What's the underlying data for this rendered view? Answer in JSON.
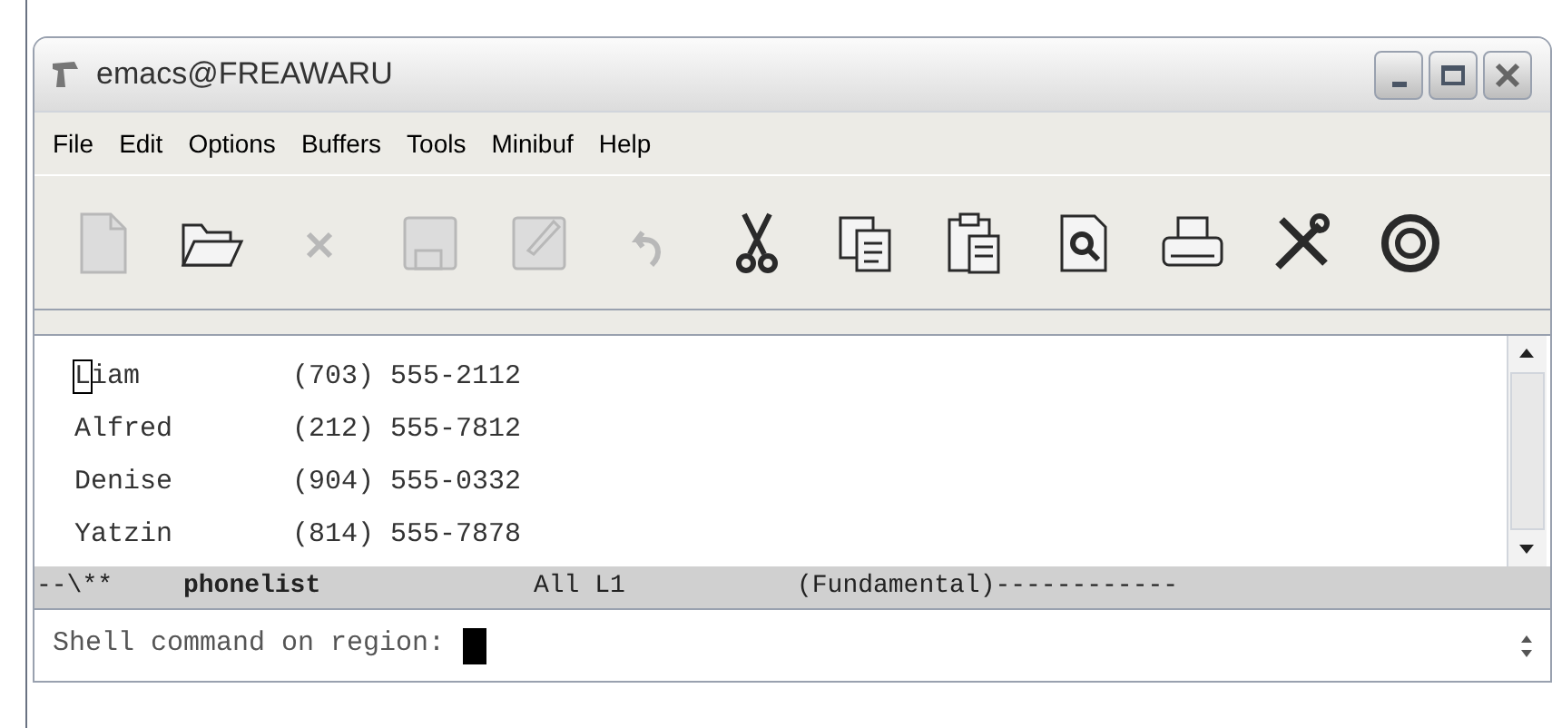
{
  "window": {
    "title": "emacs@FREAWARU"
  },
  "menu": [
    "File",
    "Edit",
    "Options",
    "Buffers",
    "Tools",
    "Minibuf",
    "Help"
  ],
  "toolbar": [
    {
      "kind": "new",
      "disabled": true
    },
    {
      "kind": "open",
      "disabled": false
    },
    {
      "kind": "close",
      "disabled": true
    },
    {
      "kind": "save",
      "disabled": true
    },
    {
      "kind": "saveas",
      "disabled": true
    },
    {
      "kind": "undo",
      "disabled": true
    },
    {
      "kind": "cut",
      "disabled": false
    },
    {
      "kind": "copy",
      "disabled": false
    },
    {
      "kind": "paste",
      "disabled": false
    },
    {
      "kind": "search",
      "disabled": false
    },
    {
      "kind": "print",
      "disabled": false
    },
    {
      "kind": "tools",
      "disabled": false
    },
    {
      "kind": "help",
      "disabled": false
    }
  ],
  "buffer": {
    "lines": [
      {
        "name": "Liam",
        "phone": "(703) 555-2112",
        "cursor": true
      },
      {
        "name": "Alfred",
        "phone": "(212) 555-7812",
        "cursor": false
      },
      {
        "name": "Denise",
        "phone": "(904) 555-0332",
        "cursor": false
      },
      {
        "name": "Yatzin",
        "phone": "(814) 555-7878",
        "cursor": false
      }
    ]
  },
  "mode_line": {
    "status": "--\\**",
    "buffer_name": "phonelist",
    "position": "All L1",
    "mode": "(Fundamental)",
    "fill": "------------"
  },
  "minibuffer": {
    "prompt": "Shell command on region:"
  }
}
